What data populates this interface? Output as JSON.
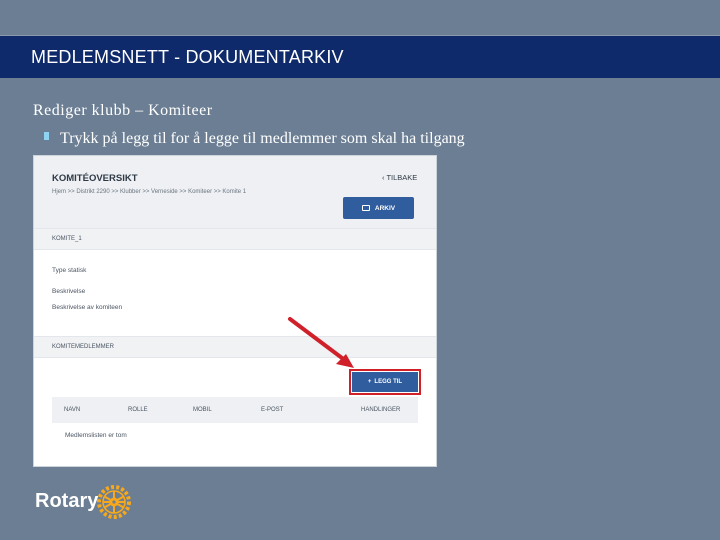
{
  "slide": {
    "title": "MEDLEMSNETT - DOKUMENTARKIV",
    "subtitle": "Rediger klubb – Komiteer",
    "bullet": "Trykk på legg til for å legge til medlemmer som skal ha tilgang",
    "colors": {
      "background": "#6b7e93",
      "title_bar": "#0f2a6b",
      "bullet_accent": "#8fd3f4",
      "highlight": "#d0212a",
      "button": "#2f5d9e"
    }
  },
  "screenshot": {
    "header_title": "KOMITÉOVERSIKT",
    "back_label": "TILBAKE",
    "back_icon": "chevron-left-icon",
    "breadcrumb": "Hjem >> Distrikt 2290 >> Klubber >> Verneside >> Komiteer >> Komite 1",
    "archive_button": "ARKIV",
    "archive_icon": "folder-icon",
    "section_committee": "KOMITE_1",
    "type_line": "Type statisk",
    "description_label": "Beskrivelse",
    "description_value": "Beskrivelse av komiteen",
    "section_members": "KOMITEMEDLEMMER",
    "add_button": "LEGG TIL",
    "add_icon": "plus-icon",
    "columns": [
      "NAVN",
      "ROLLE",
      "MOBIL",
      "E-POST",
      "HANDLINGER"
    ],
    "empty_text": "Medlemslisten er tom"
  },
  "logo": {
    "text": "Rotary",
    "icon": "rotary-wheel-icon"
  }
}
